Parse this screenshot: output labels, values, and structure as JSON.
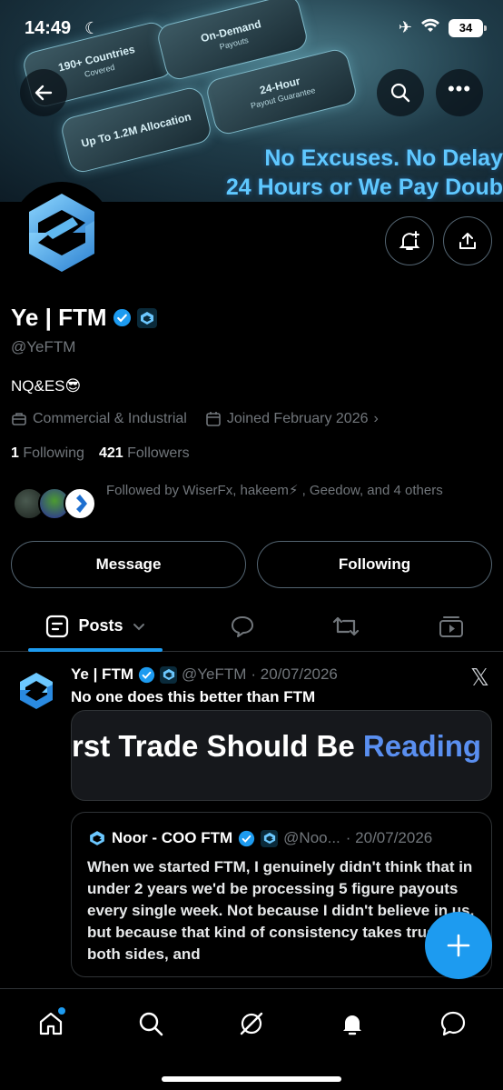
{
  "status_bar": {
    "time": "14:49",
    "battery": "34"
  },
  "banner": {
    "tiles": [
      {
        "title": "190+ Countries",
        "subtitle": "Covered"
      },
      {
        "title": "On-Demand",
        "subtitle": "Payouts"
      },
      {
        "title": "24-Hour",
        "subtitle": "Payout Guarantee"
      },
      {
        "title": "Up To 1.2M Allocation",
        "subtitle": ""
      }
    ],
    "line1": "No Excuses. No Delay",
    "line2": "24 Hours or We Pay Doub"
  },
  "profile": {
    "name": "Ye | FTM",
    "handle": "@YeFTM",
    "bio": "NQ&ES😎",
    "category": "Commercial & Industrial",
    "joined": "Joined February 2026",
    "following_count": "1",
    "following_label": "Following",
    "followers_count": "421",
    "followers_label": "Followers",
    "followed_by": "Followed by WiserFx, hakeem⚡ , Geedow, and 4 others"
  },
  "actions": {
    "message": "Message",
    "following": "Following"
  },
  "tabs": {
    "posts": "Posts"
  },
  "post": {
    "author": "Ye | FTM",
    "handle": "@YeFTM",
    "date": "· 20/07/2026",
    "text": "No one does this better than FTM",
    "card_text": "rst Trade Should Be ",
    "card_accent": "Reading",
    "quote": {
      "author": "Noor - COO FTM",
      "handle": "@Noo...",
      "date": "· 20/07/2026",
      "text": "When we started FTM, I genuinely didn't think that in under 2 years we'd be processing 5 figure payouts every single week. Not because I didn't believe in us, but because that kind of consistency takes trust on both sides, and"
    }
  },
  "colors": {
    "accent": "#1d9bf0",
    "muted": "#71767b"
  }
}
